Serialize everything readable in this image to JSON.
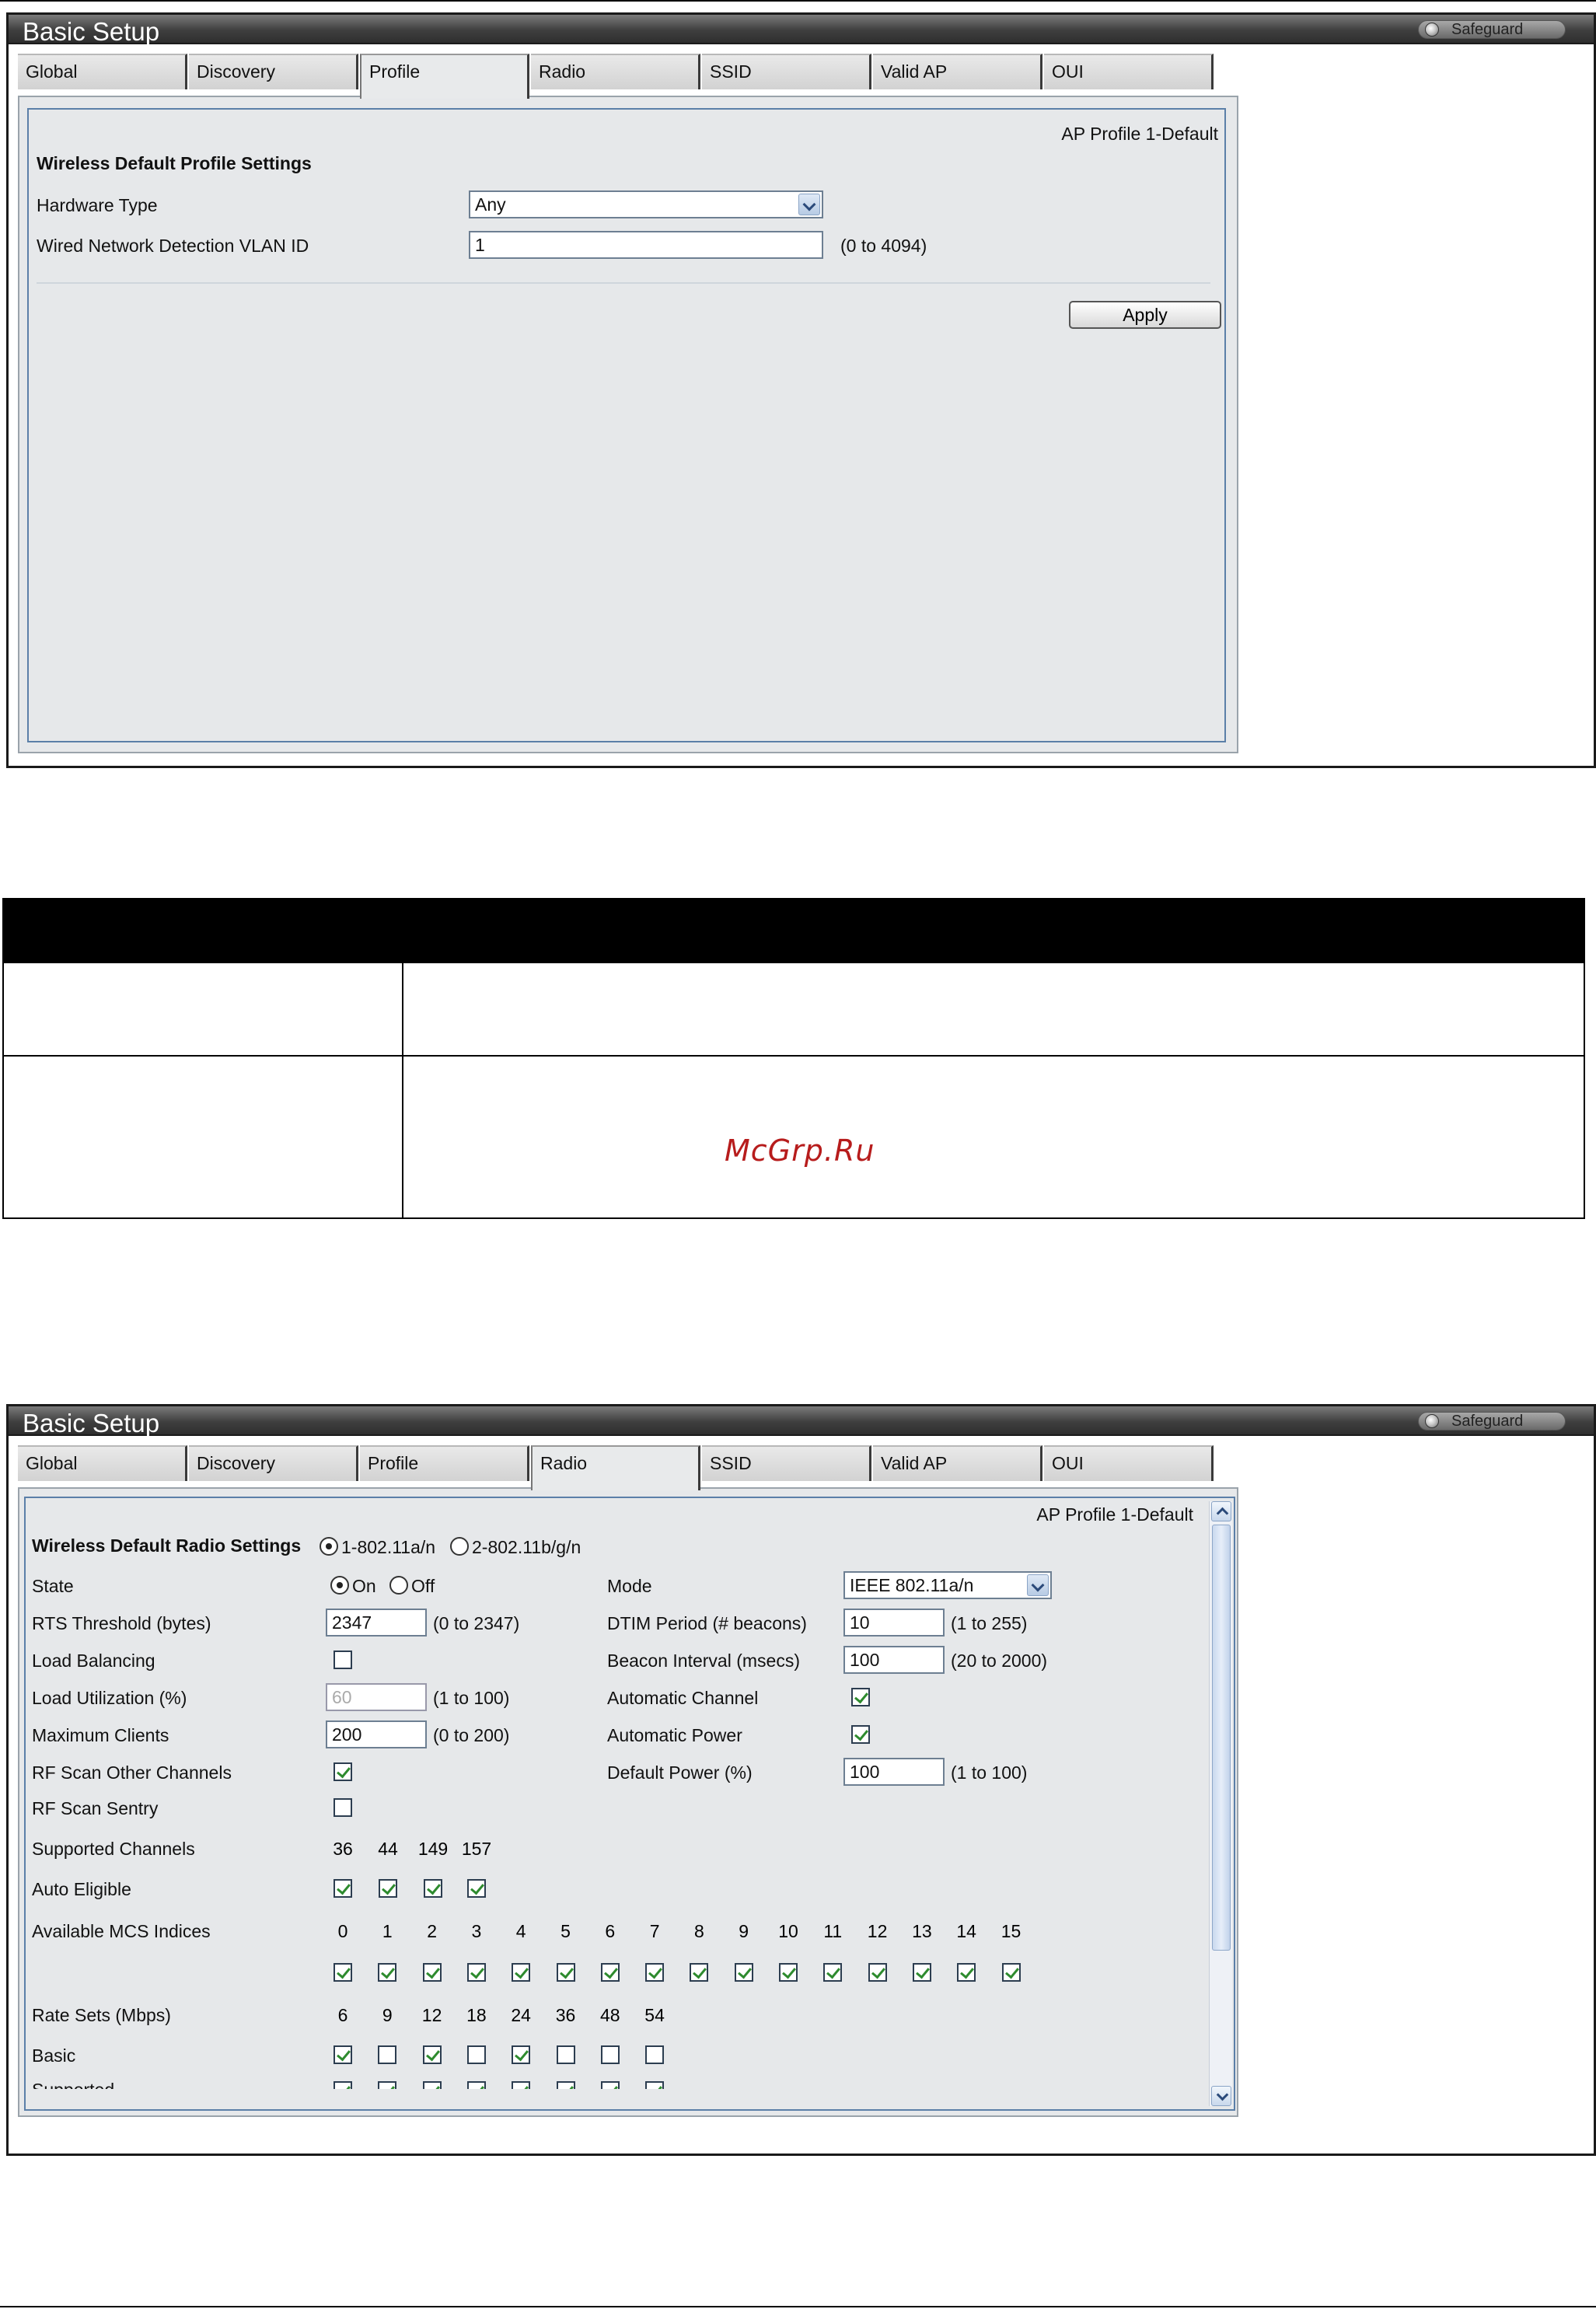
{
  "app": {
    "title": "Basic Setup",
    "safeguard": "Safeguard"
  },
  "tabs": [
    "Global",
    "Discovery",
    "Profile",
    "Radio",
    "SSID",
    "Valid AP",
    "OUI"
  ],
  "profile_view": {
    "active_tab": "Profile",
    "ap_profile": "AP Profile  1-Default",
    "section_title": "Wireless Default Profile Settings",
    "hardware_type_label": "Hardware Type",
    "hardware_type_value": "Any",
    "vlan_label": "Wired Network Detection VLAN ID",
    "vlan_value": "1",
    "vlan_range": "(0 to 4094)",
    "apply_label": "Apply"
  },
  "watermark": "McGrp.Ru",
  "radio_view": {
    "active_tab": "Radio",
    "ap_profile": "AP Profile  1-Default",
    "section_title": "Wireless Default Radio Settings",
    "radio_options": [
      "1-802.11a/n",
      "2-802.11b/g/n"
    ],
    "selected_radio": "1-802.11a/n",
    "left": {
      "state_label": "State",
      "state_on": "On",
      "state_off": "Off",
      "state_value": "On",
      "rts_label": "RTS Threshold (bytes)",
      "rts_value": "2347",
      "rts_range": "(0 to 2347)",
      "load_balancing_label": "Load Balancing",
      "load_balancing": false,
      "load_util_label": "Load Utilization (%)",
      "load_util_value": "60",
      "load_util_range": "(1 to 100)",
      "max_clients_label": "Maximum Clients",
      "max_clients_value": "200",
      "max_clients_range": "(0 to 200)",
      "rf_scan_other_label": "RF Scan Other Channels",
      "rf_scan_other": true,
      "rf_scan_sentry_label": "RF Scan Sentry",
      "rf_scan_sentry": false
    },
    "right": {
      "mode_label": "Mode",
      "mode_value": "IEEE 802.11a/n",
      "dtim_label": "DTIM Period (# beacons)",
      "dtim_value": "10",
      "dtim_range": "(1 to 255)",
      "beacon_label": "Beacon Interval (msecs)",
      "beacon_value": "100",
      "beacon_range": "(20 to 2000)",
      "auto_channel_label": "Automatic Channel",
      "auto_channel": true,
      "auto_power_label": "Automatic Power",
      "auto_power": true,
      "default_power_label": "Default Power (%)",
      "default_power_value": "100",
      "default_power_range": "(1 to 100)"
    },
    "supported_channels_label": "Supported Channels",
    "supported_channels": [
      "36",
      "44",
      "149",
      "157"
    ],
    "auto_eligible_label": "Auto Eligible",
    "auto_eligible": [
      true,
      true,
      true,
      true
    ],
    "mcs_label": "Available MCS Indices",
    "mcs_indices": [
      "0",
      "1",
      "2",
      "3",
      "4",
      "5",
      "6",
      "7",
      "8",
      "9",
      "10",
      "11",
      "12",
      "13",
      "14",
      "15"
    ],
    "mcs_checked": [
      true,
      true,
      true,
      true,
      true,
      true,
      true,
      true,
      true,
      true,
      true,
      true,
      true,
      true,
      true,
      true
    ],
    "rate_sets_label": "Rate Sets (Mbps)",
    "rate_sets": [
      "6",
      "9",
      "12",
      "18",
      "24",
      "36",
      "48",
      "54"
    ],
    "basic_label": "Basic",
    "basic": [
      true,
      false,
      true,
      false,
      true,
      false,
      false,
      false
    ],
    "supported_label": "Supported",
    "supported": [
      true,
      true,
      true,
      true,
      true,
      true,
      true,
      true
    ]
  }
}
